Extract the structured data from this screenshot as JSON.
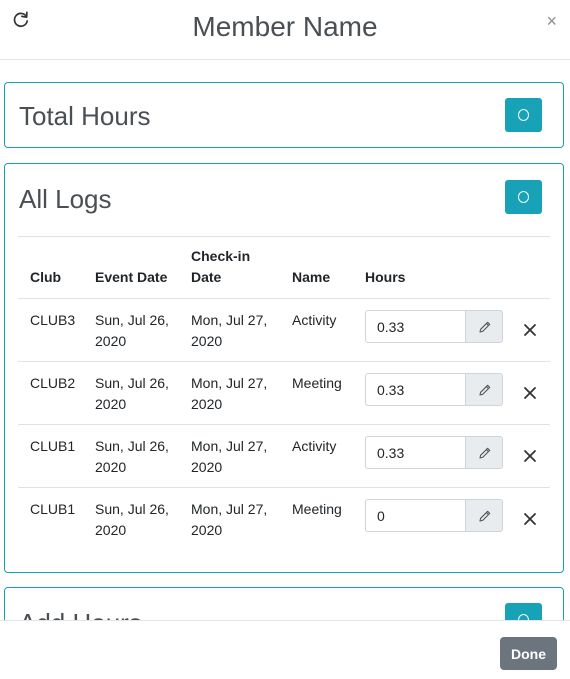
{
  "modal": {
    "title": "Member Name",
    "refresh_icon": "refresh-icon",
    "close_glyph": "×"
  },
  "total_hours": {
    "title": "Total Hours",
    "toggle_icon": "circle-icon"
  },
  "all_logs": {
    "title": "All Logs",
    "toggle_icon": "circle-icon",
    "columns": [
      "Club",
      "Event Date",
      "Check-in Date",
      "Name",
      "Hours"
    ],
    "rows": [
      {
        "club": "CLUB3",
        "event_date": "Sun, Jul 26, 2020",
        "checkin_date": "Mon, Jul 27, 2020",
        "name": "Activity",
        "hours": "0.33"
      },
      {
        "club": "CLUB2",
        "event_date": "Sun, Jul 26, 2020",
        "checkin_date": "Mon, Jul 27, 2020",
        "name": "Meeting",
        "hours": "0.33"
      },
      {
        "club": "CLUB1",
        "event_date": "Sun, Jul 26, 2020",
        "checkin_date": "Mon, Jul 27, 2020",
        "name": "Activity",
        "hours": "0.33"
      },
      {
        "club": "CLUB1",
        "event_date": "Sun, Jul 26, 2020",
        "checkin_date": "Mon, Jul 27, 2020",
        "name": "Meeting",
        "hours": "0"
      }
    ]
  },
  "add_hours": {
    "title": "Add Hours",
    "toggle_icon": "circle-icon"
  },
  "footer": {
    "done_label": "Done"
  },
  "colors": {
    "accent": "#17a2b8",
    "done_button": "#6c757d",
    "title_text": "#4a4f54"
  }
}
